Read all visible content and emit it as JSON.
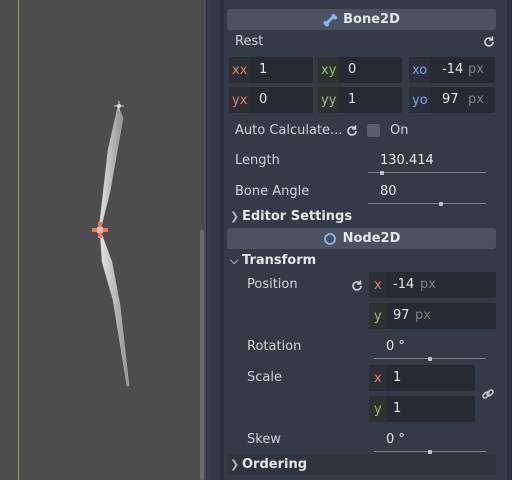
{
  "viewport": {},
  "bone2d": {
    "header": "Bone2D",
    "rest_label": "Rest",
    "rest_fields": [
      {
        "tag": "xx",
        "value": "1"
      },
      {
        "tag": "xy",
        "value": "0"
      },
      {
        "tag": "xo",
        "value": "-14",
        "unit": "px"
      },
      {
        "tag": "yx",
        "value": "0"
      },
      {
        "tag": "yy",
        "value": "1"
      },
      {
        "tag": "yo",
        "value": "97",
        "unit": "px"
      }
    ],
    "auto_calculate_label": "Auto Calculate...",
    "auto_calculate_value": "On",
    "length_label": "Length",
    "length_value": "130.414",
    "bone_angle_label": "Bone Angle",
    "bone_angle_value": "80",
    "editor_settings_label": "Editor Settings"
  },
  "node2d": {
    "header": "Node2D",
    "transform_label": "Transform",
    "position_label": "Position",
    "position_x": {
      "tag": "x",
      "value": "-14",
      "unit": "px"
    },
    "position_y": {
      "tag": "y",
      "value": "97",
      "unit": "px"
    },
    "rotation_label": "Rotation",
    "rotation_value": "0 °",
    "scale_label": "Scale",
    "scale_x": {
      "tag": "x",
      "value": "1"
    },
    "scale_y": {
      "tag": "y",
      "value": "1"
    },
    "skew_label": "Skew",
    "skew_value": "0 °",
    "ordering_label": "Ordering"
  },
  "sliders": {
    "length_fraction": 0.12,
    "bone_angle_fraction": 0.62,
    "rotation_fraction": 0.5,
    "skew_fraction": 0.5
  },
  "colors": {
    "accent_blue": "#8fb4f0",
    "axis_green": "#86a35f",
    "tag_red": "#d8816f",
    "tag_green": "#97c06c",
    "tag_blue": "#7ea3d8"
  },
  "icons": {
    "bone": "bone2d-icon",
    "node": "node2d-icon",
    "reset": "reset-icon",
    "link": "link-icon",
    "origin": "origin-cross-icon"
  }
}
